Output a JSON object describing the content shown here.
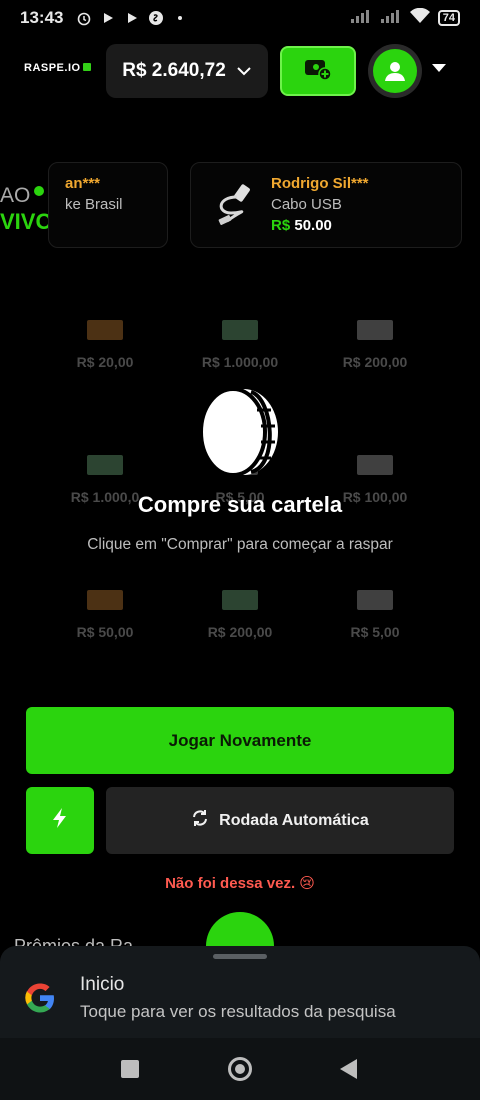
{
  "status": {
    "time": "13:43",
    "battery": "74"
  },
  "header": {
    "logo": "RASPE.IO",
    "currency": "R$",
    "balance": "2.640,72"
  },
  "live": {
    "label_part": "AO",
    "label_vivo": "VIVO"
  },
  "feed": [
    {
      "name": "an***",
      "prize": "ke Brasil",
      "value": ""
    },
    {
      "name": "Rodrigo Sil***",
      "prize": "Cabo USB",
      "currency": "R$",
      "value": "50.00"
    }
  ],
  "grid": [
    {
      "amount": "R$ 20,00",
      "color": "#d98c3a"
    },
    {
      "amount": "R$ 1.000,00",
      "color": "#7fc48d"
    },
    {
      "amount": "R$ 200,00",
      "color": "#b7b7b7"
    },
    {
      "amount": "R$ 1.000,0",
      "color": "#7fc48d"
    },
    {
      "amount": "R$ 5,00",
      "color": "#b7b7b7"
    },
    {
      "amount": "R$ 100,00",
      "color": "#b7b7b7"
    },
    {
      "amount": "R$ 50,00",
      "color": "#d98c3a"
    },
    {
      "amount": "R$ 200,00",
      "color": "#7fc48d"
    },
    {
      "amount": "R$ 5,00",
      "color": "#b7b7b7"
    }
  ],
  "overlay": {
    "title": "Compre sua cartela",
    "subtitle": "Clique em \"Comprar\" para começar a raspar"
  },
  "actions": {
    "play_again": "Jogar Novamente",
    "auto_round": "Rodada Automática"
  },
  "result": {
    "message": "Não foi dessa vez. 😢"
  },
  "partial": {
    "title": "Prêmios da Ra"
  },
  "google_sheet": {
    "title": "Inicio",
    "subtitle": "Toque para ver os resultados da pesquisa"
  },
  "colors": {
    "accent": "#2bd40e",
    "error": "#ff5a50",
    "feed_name": "#f0a830"
  },
  "icons": {
    "deposit": "wallet-plus-icon",
    "avatar": "user-icon",
    "coin": "coin-icon",
    "turbo": "lightning-icon",
    "auto": "refresh-icon",
    "google": "google-logo-icon"
  }
}
